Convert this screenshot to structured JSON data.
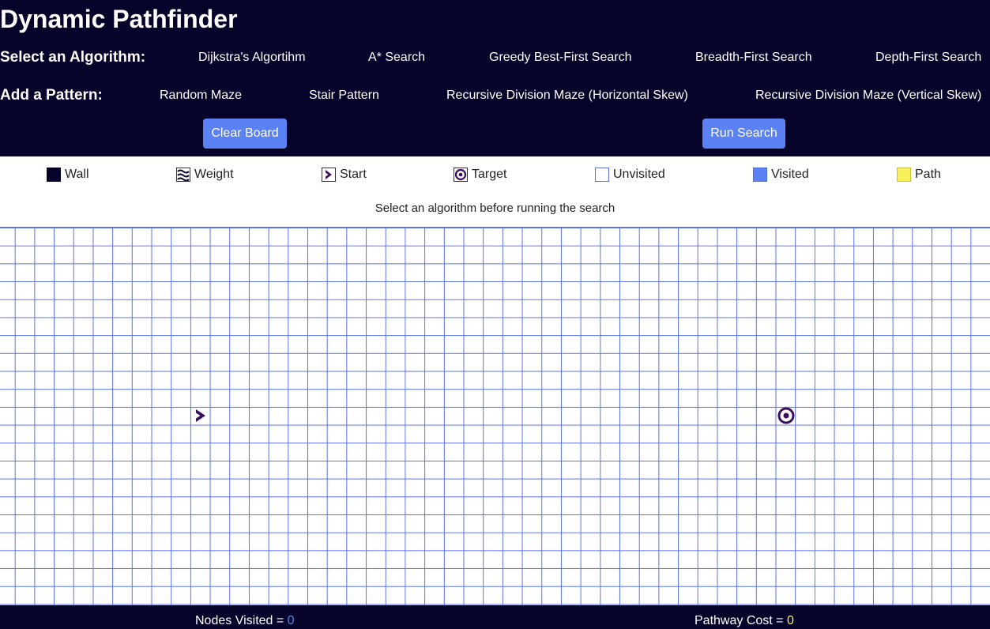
{
  "header": {
    "title": "Dynamic Pathfinder",
    "algorithm_label": "Select an Algorithm:",
    "algorithms": [
      "Dijkstra's Algortihm",
      "A* Search",
      "Greedy Best-First Search",
      "Breadth-First Search",
      "Depth-First Search"
    ],
    "pattern_label": "Add a Pattern:",
    "patterns": [
      "Random Maze",
      "Stair Pattern",
      "Recursive Division Maze (Horizontal Skew)",
      "Recursive Division Maze (Vertical Skew)"
    ],
    "clear_label": "Clear Board",
    "run_label": "Run Search"
  },
  "legend": [
    {
      "label": "Wall",
      "icon": "wall-swatch"
    },
    {
      "label": "Weight",
      "icon": "weight-icon"
    },
    {
      "label": "Start",
      "icon": "start-chevron-icon"
    },
    {
      "label": "Target",
      "icon": "target-icon"
    },
    {
      "label": "Unvisited",
      "icon": "unvisited-swatch"
    },
    {
      "label": "Visited",
      "icon": "visited-swatch"
    },
    {
      "label": "Path",
      "icon": "path-swatch"
    }
  ],
  "status": "Select an algorithm before running the search",
  "grid": {
    "start_icon": "start-chevron-icon",
    "target_icon": "target-icon"
  },
  "footer": {
    "nodes_label": "Nodes Visited = ",
    "nodes_value": "0",
    "cost_label": "Pathway Cost = ",
    "cost_value": "0"
  },
  "colors": {
    "header_bg": "#05032a",
    "accent": "#5b82f4",
    "path": "#f7f05a",
    "node_icon": "#3a0f5e"
  }
}
